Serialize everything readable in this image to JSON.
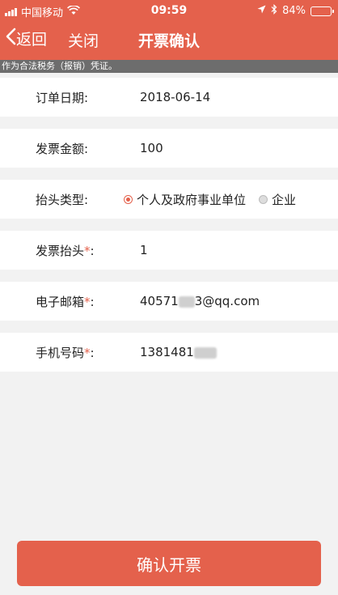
{
  "status_bar": {
    "carrier": "中国移动",
    "time": "09:59",
    "battery": "84%",
    "battery_level": 0.84
  },
  "nav": {
    "back_label": "返回",
    "close_label": "关闭",
    "title": "开票确认"
  },
  "notice": "作为合法税务（报销）凭证。",
  "form": {
    "order_date": {
      "label": "订单日期:",
      "value": "2018-06-14"
    },
    "amount": {
      "label": "发票金额:",
      "value": "100"
    },
    "title_type": {
      "label": "抬头类型:",
      "options": [
        "个人及政府事业单位",
        "企业"
      ],
      "selected": "个人及政府事业单位"
    },
    "invoice_title": {
      "label": "发票抬头",
      "required_mark": "*",
      "suffix": ":",
      "value": "1"
    },
    "email": {
      "label": "电子邮箱",
      "required_mark": "*",
      "suffix": ":",
      "value_prefix": "40571",
      "value_suffix": "3@qq.com"
    },
    "phone": {
      "label": "手机号码",
      "required_mark": "*",
      "suffix": ":",
      "value_prefix": "1381481"
    }
  },
  "confirm_button": "确认开票",
  "colors": {
    "accent": "#e4614c",
    "notice_bg": "#6d6d6d",
    "background": "#f2f2f2"
  }
}
